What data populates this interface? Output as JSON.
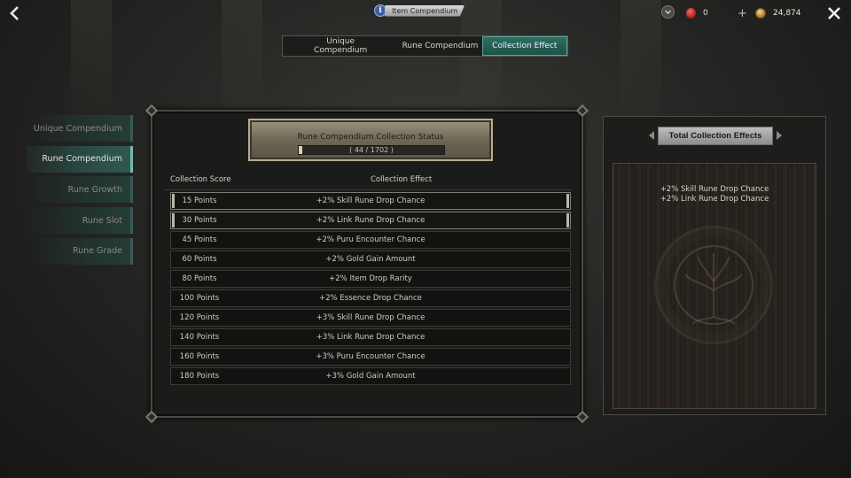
{
  "header": {
    "title": "Item Compendium",
    "info_icon": "info-icon",
    "currencies": [
      {
        "name": "ruby-gem-icon",
        "value": "0"
      },
      {
        "name": "gold-coin-icon",
        "value": "24,874"
      }
    ]
  },
  "tabs": [
    {
      "label": "Unique Compendium",
      "active": false
    },
    {
      "label": "Rune Compendium",
      "active": false
    },
    {
      "label": "Collection Effect",
      "active": true
    }
  ],
  "sidebar": {
    "items": [
      {
        "label": "Unique Compendium",
        "active": false
      },
      {
        "label": "Rune Compendium",
        "active": true
      },
      {
        "label": "Rune Growth",
        "active": false
      },
      {
        "label": "Rune Slot",
        "active": false
      },
      {
        "label": "Rune Grade",
        "active": false
      }
    ]
  },
  "status": {
    "title": "Rune Compendium Collection Status",
    "progress_text": "( 44 / 1702 )",
    "progress_current": 44,
    "progress_total": 1702
  },
  "table": {
    "headers": {
      "score": "Collection Score",
      "effect": "Collection Effect"
    },
    "rows": [
      {
        "score": "15 Points",
        "effect": "+2% Skill Rune Drop Chance",
        "achieved": true
      },
      {
        "score": "30 Points",
        "effect": "+2% Link Rune Drop Chance",
        "achieved": true
      },
      {
        "score": "45 Points",
        "effect": "+2% Puru Encounter Chance",
        "achieved": false
      },
      {
        "score": "60 Points",
        "effect": "+2% Gold Gain Amount",
        "achieved": false
      },
      {
        "score": "80 Points",
        "effect": "+2% Item Drop Rarity",
        "achieved": false
      },
      {
        "score": "100 Points",
        "effect": "+2% Essence Drop Chance",
        "achieved": false
      },
      {
        "score": "120 Points",
        "effect": "+3% Skill Rune Drop Chance",
        "achieved": false
      },
      {
        "score": "140 Points",
        "effect": "+3% Link Rune Drop Chance",
        "achieved": false
      },
      {
        "score": "160 Points",
        "effect": "+3% Puru Encounter Chance",
        "achieved": false
      },
      {
        "score": "180 Points",
        "effect": "+3% Gold Gain Amount",
        "achieved": false
      }
    ]
  },
  "total_effects": {
    "title": "Total Collection Effects",
    "effects": [
      "+2% Skill Rune Drop Chance",
      "+2% Link Rune Drop Chance"
    ]
  },
  "colors": {
    "accent": "#2e6e63",
    "panel": "#1b1b1a",
    "plate": "#8a826e"
  }
}
